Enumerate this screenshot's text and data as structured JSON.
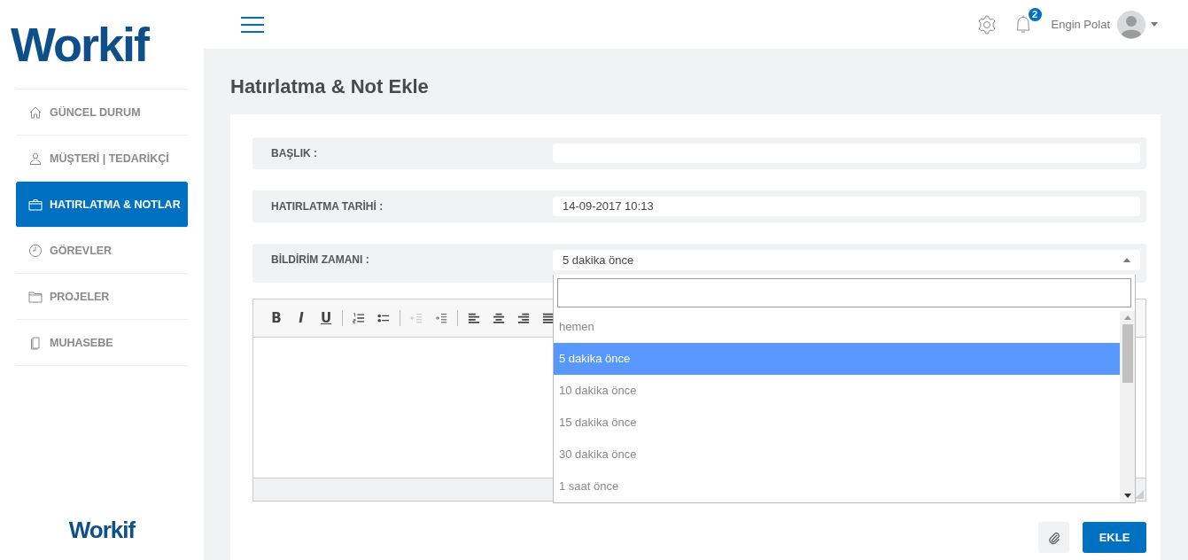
{
  "sidebar": {
    "logo": "Workif",
    "items": [
      {
        "label": "GÜNCEL DURUM",
        "selected": false
      },
      {
        "label": "MÜŞTERİ | TEDARİKÇİ",
        "selected": false
      },
      {
        "label": "HATIRLATMA & NOTLAR",
        "selected": true
      },
      {
        "label": "GÖREVLER",
        "selected": false
      },
      {
        "label": "PROJELER",
        "selected": false
      },
      {
        "label": "MUHASEBE",
        "selected": false
      }
    ],
    "footer_logo": "Workif"
  },
  "topbar": {
    "notification_count": "2",
    "user_name": "Engin Polat"
  },
  "page_title": "Hatırlatma & Not Ekle",
  "form": {
    "fields": [
      {
        "kind": "text",
        "label": "BAŞLIK :"
      },
      {
        "kind": "text",
        "label": "HATIRLATMA TARİHİ :",
        "value": "14-09-2017 10:13"
      },
      {
        "kind": "select",
        "label": "BİLDİRİM ZAMANI :",
        "value": "5 dakika önce",
        "expanded": true,
        "options": [
          {
            "label": "hemen",
            "selected": false
          },
          {
            "label": "5 dakika önce",
            "selected": true
          },
          {
            "label": "10 dakika önce",
            "selected": false
          },
          {
            "label": "15 dakika önce",
            "selected": false
          },
          {
            "label": "30 dakika önce",
            "selected": false
          },
          {
            "label": "1 saat önce",
            "selected": false
          }
        ]
      }
    ],
    "editor": {
      "toolbar_letters": [
        "B",
        "I",
        "U"
      ]
    },
    "buttons": {
      "submit": "EKLE"
    }
  }
}
